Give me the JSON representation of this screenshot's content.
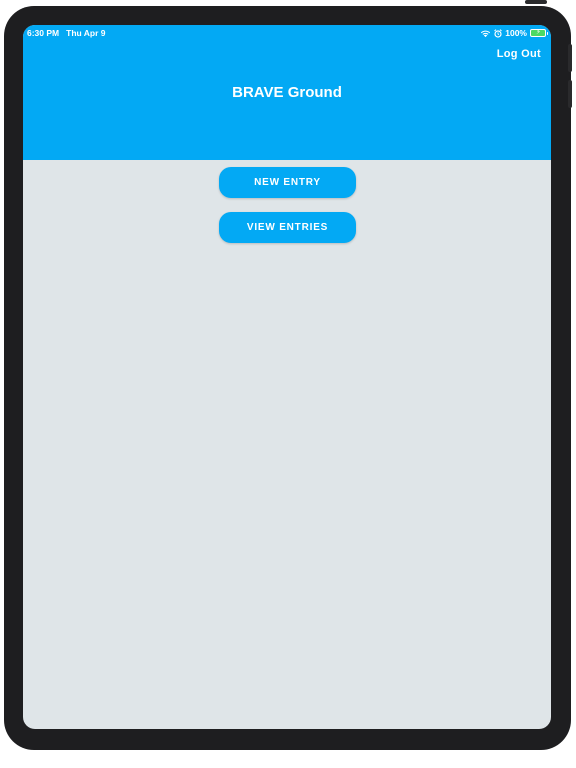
{
  "status_bar": {
    "time": "6:30 PM",
    "date": "Thu Apr 9",
    "battery_percent": "100%",
    "battery_level": 1.0,
    "battery_color": "#4cd964",
    "icons": [
      "wifi-icon",
      "alarm-icon",
      "battery-icon"
    ]
  },
  "header": {
    "title": "BRAVE Ground",
    "logout_label": "Log Out",
    "background_color": "#03a9f4"
  },
  "main": {
    "new_entry_label": "NEW ENTRY",
    "view_entries_label": "VIEW ENTRIES",
    "background_color": "#dfe5e8"
  }
}
